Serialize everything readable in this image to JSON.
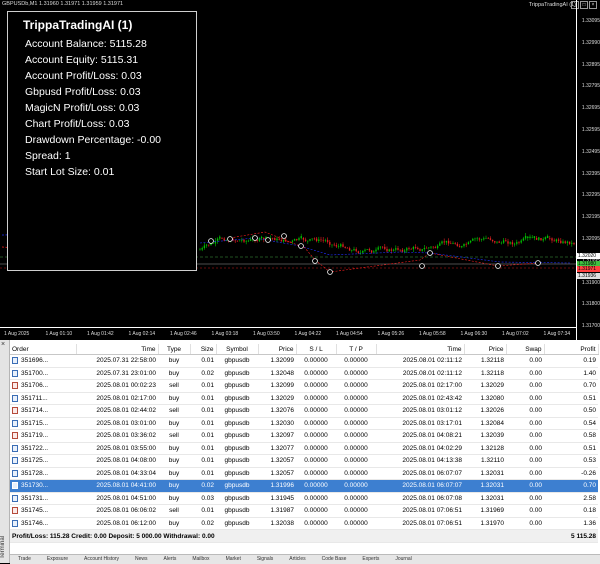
{
  "chart": {
    "symbol_label": "GBPUSDb,M1  1.31960 1.31971 1.31959 1.31971",
    "ea_label": "TrippaTradingAI (1)",
    "price_ticks": [
      "1.33095",
      "1.32990",
      "1.32895",
      "1.32795",
      "1.32695",
      "1.32595",
      "1.32495",
      "1.32395",
      "1.32295",
      "1.32195",
      "1.32095",
      "1.31995",
      "1.31900",
      "1.31800",
      "1.31700"
    ],
    "price_tags": [
      "1.32020",
      "1.31980",
      "1.31971",
      "1.31936"
    ],
    "time_ticks": [
      "1 Aug 2025",
      "1 Aug 01:10",
      "1 Aug 01:42",
      "1 Aug 02:14",
      "1 Aug 02:46",
      "1 Aug 03:18",
      "1 Aug 03:50",
      "1 Aug 04:22",
      "1 Aug 04:54",
      "1 Aug 05:26",
      "1 Aug 05:58",
      "1 Aug 06:30",
      "1 Aug 07:02",
      "1 Aug 07:34"
    ],
    "left_level_label": "01",
    "colors": {
      "bull_candle": "#00c000",
      "bear_candle": "#e02020",
      "buy_line": "#2030ff",
      "sell_line": "#ff2020",
      "level_line": "#40a040"
    }
  },
  "info_panel": {
    "title": "TrippaTradingAI (1)",
    "lines": [
      "Account Balance: 5115.28",
      "Account Equity: 5115.31",
      "Account Profit/Loss: 0.03",
      "Gbpusd Profit/Loss: 0.03",
      "MagicN Profit/Loss: 0.03",
      "Chart Profit/Loss: 0.03",
      "Drawdown Percentage: -0.00",
      "Spread: 1",
      "Start Lot Size: 0.01"
    ]
  },
  "terminal": {
    "side_label": "Terminal",
    "close_icon": "close-icon",
    "columns": [
      "Order",
      "Time",
      "Type",
      "Size",
      "Symbol",
      "Price",
      "S / L",
      "T / P",
      "Time",
      "Price",
      "Swap",
      "Profit"
    ],
    "rows": [
      [
        "351696...",
        "2025.07.31 22:58:00",
        "buy",
        "0.01",
        "gbpusdb",
        "1.32099",
        "0.00000",
        "0.00000",
        "2025.08.01 02:11:12",
        "1.32118",
        "0.00",
        "0.19"
      ],
      [
        "351700...",
        "2025.07.31 23:01:00",
        "buy",
        "0.02",
        "gbpusdb",
        "1.32048",
        "0.00000",
        "0.00000",
        "2025.08.01 02:11:12",
        "1.32118",
        "0.00",
        "1.40"
      ],
      [
        "351706...",
        "2025.08.01 00:02:23",
        "sell",
        "0.01",
        "gbpusdb",
        "1.32099",
        "0.00000",
        "0.00000",
        "2025.08.01 02:17:00",
        "1.32029",
        "0.00",
        "0.70"
      ],
      [
        "351711...",
        "2025.08.01 02:17:00",
        "buy",
        "0.01",
        "gbpusdb",
        "1.32029",
        "0.00000",
        "0.00000",
        "2025.08.01 02:43:42",
        "1.32080",
        "0.00",
        "0.51"
      ],
      [
        "351714...",
        "2025.08.01 02:44:02",
        "sell",
        "0.01",
        "gbpusdb",
        "1.32076",
        "0.00000",
        "0.00000",
        "2025.08.01 03:01:12",
        "1.32026",
        "0.00",
        "0.50"
      ],
      [
        "351715...",
        "2025.08.01 03:01:00",
        "buy",
        "0.01",
        "gbpusdb",
        "1.32030",
        "0.00000",
        "0.00000",
        "2025.08.01 03:17:01",
        "1.32084",
        "0.00",
        "0.54"
      ],
      [
        "351719...",
        "2025.08.01 03:36:02",
        "sell",
        "0.01",
        "gbpusdb",
        "1.32097",
        "0.00000",
        "0.00000",
        "2025.08.01 04:08:21",
        "1.32039",
        "0.00",
        "0.58"
      ],
      [
        "351722...",
        "2025.08.01 03:55:00",
        "buy",
        "0.01",
        "gbpusdb",
        "1.32077",
        "0.00000",
        "0.00000",
        "2025.08.01 04:02:29",
        "1.32128",
        "0.00",
        "0.51"
      ],
      [
        "351725...",
        "2025.08.01 04:08:00",
        "buy",
        "0.01",
        "gbpusdb",
        "1.32057",
        "0.00000",
        "0.00000",
        "2025.08.01 04:13:38",
        "1.32110",
        "0.00",
        "0.53"
      ],
      [
        "351728...",
        "2025.08.01 04:33:04",
        "buy",
        "0.01",
        "gbpusdb",
        "1.32057",
        "0.00000",
        "0.00000",
        "2025.08.01 06:07:07",
        "1.32031",
        "0.00",
        "-0.26"
      ],
      [
        "351730...",
        "2025.08.01 04:41:00",
        "buy",
        "0.02",
        "gbpusdb",
        "1.31996",
        "0.00000",
        "0.00000",
        "2025.08.01 06:07:07",
        "1.32031",
        "0.00",
        "0.70"
      ],
      [
        "351731...",
        "2025.08.01 04:51:00",
        "buy",
        "0.03",
        "gbpusdb",
        "1.31945",
        "0.00000",
        "0.00000",
        "2025.08.01 06:07:08",
        "1.32031",
        "0.00",
        "2.58"
      ],
      [
        "351745...",
        "2025.08.01 06:06:02",
        "sell",
        "0.01",
        "gbpusdb",
        "1.31987",
        "0.00000",
        "0.00000",
        "2025.08.01 07:06:51",
        "1.31969",
        "0.00",
        "0.18"
      ],
      [
        "351746...",
        "2025.08.01 06:12:00",
        "buy",
        "0.02",
        "gbpusdb",
        "1.32038",
        "0.00000",
        "0.00000",
        "2025.08.01 07:06:51",
        "1.31970",
        "0.00",
        "1.36"
      ]
    ],
    "selected_row": 10,
    "summary_left": "Profit/Loss: 115.28  Credit: 0.00  Deposit: 5 000.00  Withdrawal: 0.00",
    "summary_right": "5 115.28",
    "tabs": [
      "Trade",
      "Exposure",
      "Account History",
      "News",
      "Alerts",
      "Mailbox",
      "Market",
      "Signals",
      "Articles",
      "Code Base",
      "Experts",
      "Journal"
    ]
  }
}
